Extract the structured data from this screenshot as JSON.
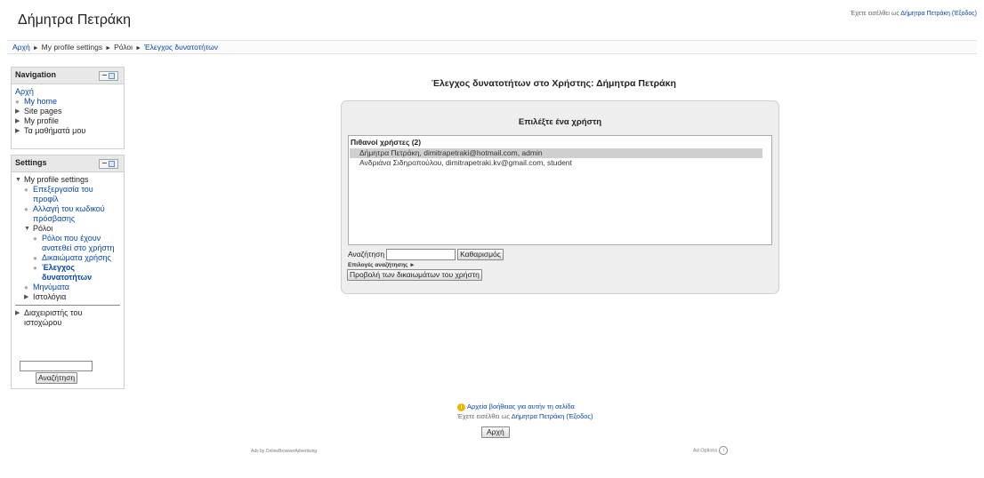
{
  "header": {
    "site_title": "Δήμητρα Πετράκη",
    "login_prefix": "Έχετε εισέλθει ως",
    "login_user": "Δήμητρα Πετράκη",
    "logout": "(Έξοδος)"
  },
  "breadcrumb": {
    "items": [
      "Αρχή",
      "My profile settings",
      "Ρόλοι",
      "Έλεγχος δυνατοτήτων"
    ],
    "separator": "►"
  },
  "navigation_block": {
    "title": "Navigation",
    "home": "Αρχή",
    "my_home": "My home",
    "site_pages": "Site pages",
    "my_profile": "My profile",
    "my_courses": "Τα μαθήματά μου"
  },
  "settings_block": {
    "title": "Settings",
    "my_profile_settings": "My profile settings",
    "edit_profile": "Επεξεργασία του προφίλ",
    "change_password": "Αλλαγή του κωδικού πρόσβασης",
    "roles": "Ρόλοι",
    "assigned_roles": "Ρόλοι που έχουν ανατεθεί στο χρήστη",
    "permissions": "Δικαιώματα χρήσης",
    "check_permissions": "Έλεγχος δυνατοτήτων",
    "messages": "Μηνύματα",
    "blogs": "Ιστολόγια",
    "site_admin": "Διαχειριστής του ιστοχώρου",
    "search_button": "Αναζήτηση"
  },
  "main": {
    "heading": "Έλεγχος δυνατοτήτων στο Χρήστης: Δήμητρα Πετράκη",
    "box_title": "Επιλέξτε ένα χρήστη",
    "optgroup_label": "Πιθανοί χρήστες (2)",
    "users": [
      "Δήμητρα Πετράκη, dimitrapetraki@hotmail.com, admin",
      "Ανδριάνα Σιδηροπούλου, dimitrapetraki.kv@gmail.com, student"
    ],
    "selected_index": 0,
    "search_label": "Αναζήτηση",
    "search_value": "",
    "clear_button": "Καθαρισμός",
    "search_options": "Επιλογές αναζήτησης",
    "search_options_arrow": "►",
    "view_permissions_button": "Προβολή των δικαιωμάτων του χρήστη"
  },
  "footer": {
    "help_link": "Αρχεία βοήθειας για αυτήν τη σελίδα",
    "login_prefix": "Έχετε εισέλθει ως",
    "login_user": "Δήμητρα Πετράκη",
    "logout": "(Έξοδος)",
    "home_button": "Αρχή",
    "ads_by": "Ads by OnlineBrowserAdvertising",
    "ad_options": "Ad Options"
  },
  "colors": {
    "link": "#0645ad",
    "block_header": "#e8e8e8",
    "box_background": "#eeeeee",
    "selected_row": "#cfcfcf"
  }
}
